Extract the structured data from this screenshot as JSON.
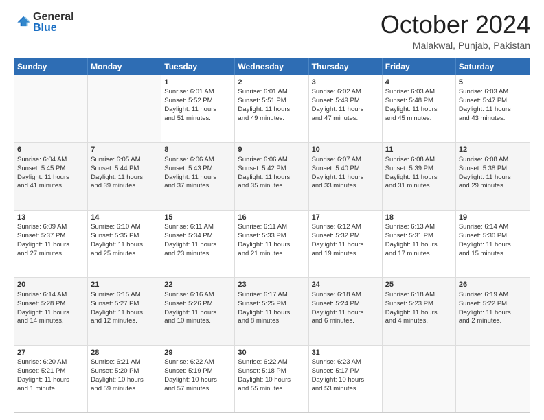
{
  "header": {
    "logo_line1": "General",
    "logo_line2": "Blue",
    "month": "October 2024",
    "location": "Malakwal, Punjab, Pakistan"
  },
  "days": [
    "Sunday",
    "Monday",
    "Tuesday",
    "Wednesday",
    "Thursday",
    "Friday",
    "Saturday"
  ],
  "weeks": [
    [
      {
        "day": "",
        "lines": []
      },
      {
        "day": "",
        "lines": []
      },
      {
        "day": "1",
        "lines": [
          "Sunrise: 6:01 AM",
          "Sunset: 5:52 PM",
          "Daylight: 11 hours",
          "and 51 minutes."
        ]
      },
      {
        "day": "2",
        "lines": [
          "Sunrise: 6:01 AM",
          "Sunset: 5:51 PM",
          "Daylight: 11 hours",
          "and 49 minutes."
        ]
      },
      {
        "day": "3",
        "lines": [
          "Sunrise: 6:02 AM",
          "Sunset: 5:49 PM",
          "Daylight: 11 hours",
          "and 47 minutes."
        ]
      },
      {
        "day": "4",
        "lines": [
          "Sunrise: 6:03 AM",
          "Sunset: 5:48 PM",
          "Daylight: 11 hours",
          "and 45 minutes."
        ]
      },
      {
        "day": "5",
        "lines": [
          "Sunrise: 6:03 AM",
          "Sunset: 5:47 PM",
          "Daylight: 11 hours",
          "and 43 minutes."
        ]
      }
    ],
    [
      {
        "day": "6",
        "lines": [
          "Sunrise: 6:04 AM",
          "Sunset: 5:45 PM",
          "Daylight: 11 hours",
          "and 41 minutes."
        ]
      },
      {
        "day": "7",
        "lines": [
          "Sunrise: 6:05 AM",
          "Sunset: 5:44 PM",
          "Daylight: 11 hours",
          "and 39 minutes."
        ]
      },
      {
        "day": "8",
        "lines": [
          "Sunrise: 6:06 AM",
          "Sunset: 5:43 PM",
          "Daylight: 11 hours",
          "and 37 minutes."
        ]
      },
      {
        "day": "9",
        "lines": [
          "Sunrise: 6:06 AM",
          "Sunset: 5:42 PM",
          "Daylight: 11 hours",
          "and 35 minutes."
        ]
      },
      {
        "day": "10",
        "lines": [
          "Sunrise: 6:07 AM",
          "Sunset: 5:40 PM",
          "Daylight: 11 hours",
          "and 33 minutes."
        ]
      },
      {
        "day": "11",
        "lines": [
          "Sunrise: 6:08 AM",
          "Sunset: 5:39 PM",
          "Daylight: 11 hours",
          "and 31 minutes."
        ]
      },
      {
        "day": "12",
        "lines": [
          "Sunrise: 6:08 AM",
          "Sunset: 5:38 PM",
          "Daylight: 11 hours",
          "and 29 minutes."
        ]
      }
    ],
    [
      {
        "day": "13",
        "lines": [
          "Sunrise: 6:09 AM",
          "Sunset: 5:37 PM",
          "Daylight: 11 hours",
          "and 27 minutes."
        ]
      },
      {
        "day": "14",
        "lines": [
          "Sunrise: 6:10 AM",
          "Sunset: 5:35 PM",
          "Daylight: 11 hours",
          "and 25 minutes."
        ]
      },
      {
        "day": "15",
        "lines": [
          "Sunrise: 6:11 AM",
          "Sunset: 5:34 PM",
          "Daylight: 11 hours",
          "and 23 minutes."
        ]
      },
      {
        "day": "16",
        "lines": [
          "Sunrise: 6:11 AM",
          "Sunset: 5:33 PM",
          "Daylight: 11 hours",
          "and 21 minutes."
        ]
      },
      {
        "day": "17",
        "lines": [
          "Sunrise: 6:12 AM",
          "Sunset: 5:32 PM",
          "Daylight: 11 hours",
          "and 19 minutes."
        ]
      },
      {
        "day": "18",
        "lines": [
          "Sunrise: 6:13 AM",
          "Sunset: 5:31 PM",
          "Daylight: 11 hours",
          "and 17 minutes."
        ]
      },
      {
        "day": "19",
        "lines": [
          "Sunrise: 6:14 AM",
          "Sunset: 5:30 PM",
          "Daylight: 11 hours",
          "and 15 minutes."
        ]
      }
    ],
    [
      {
        "day": "20",
        "lines": [
          "Sunrise: 6:14 AM",
          "Sunset: 5:28 PM",
          "Daylight: 11 hours",
          "and 14 minutes."
        ]
      },
      {
        "day": "21",
        "lines": [
          "Sunrise: 6:15 AM",
          "Sunset: 5:27 PM",
          "Daylight: 11 hours",
          "and 12 minutes."
        ]
      },
      {
        "day": "22",
        "lines": [
          "Sunrise: 6:16 AM",
          "Sunset: 5:26 PM",
          "Daylight: 11 hours",
          "and 10 minutes."
        ]
      },
      {
        "day": "23",
        "lines": [
          "Sunrise: 6:17 AM",
          "Sunset: 5:25 PM",
          "Daylight: 11 hours",
          "and 8 minutes."
        ]
      },
      {
        "day": "24",
        "lines": [
          "Sunrise: 6:18 AM",
          "Sunset: 5:24 PM",
          "Daylight: 11 hours",
          "and 6 minutes."
        ]
      },
      {
        "day": "25",
        "lines": [
          "Sunrise: 6:18 AM",
          "Sunset: 5:23 PM",
          "Daylight: 11 hours",
          "and 4 minutes."
        ]
      },
      {
        "day": "26",
        "lines": [
          "Sunrise: 6:19 AM",
          "Sunset: 5:22 PM",
          "Daylight: 11 hours",
          "and 2 minutes."
        ]
      }
    ],
    [
      {
        "day": "27",
        "lines": [
          "Sunrise: 6:20 AM",
          "Sunset: 5:21 PM",
          "Daylight: 11 hours",
          "and 1 minute."
        ]
      },
      {
        "day": "28",
        "lines": [
          "Sunrise: 6:21 AM",
          "Sunset: 5:20 PM",
          "Daylight: 10 hours",
          "and 59 minutes."
        ]
      },
      {
        "day": "29",
        "lines": [
          "Sunrise: 6:22 AM",
          "Sunset: 5:19 PM",
          "Daylight: 10 hours",
          "and 57 minutes."
        ]
      },
      {
        "day": "30",
        "lines": [
          "Sunrise: 6:22 AM",
          "Sunset: 5:18 PM",
          "Daylight: 10 hours",
          "and 55 minutes."
        ]
      },
      {
        "day": "31",
        "lines": [
          "Sunrise: 6:23 AM",
          "Sunset: 5:17 PM",
          "Daylight: 10 hours",
          "and 53 minutes."
        ]
      },
      {
        "day": "",
        "lines": []
      },
      {
        "day": "",
        "lines": []
      }
    ]
  ]
}
